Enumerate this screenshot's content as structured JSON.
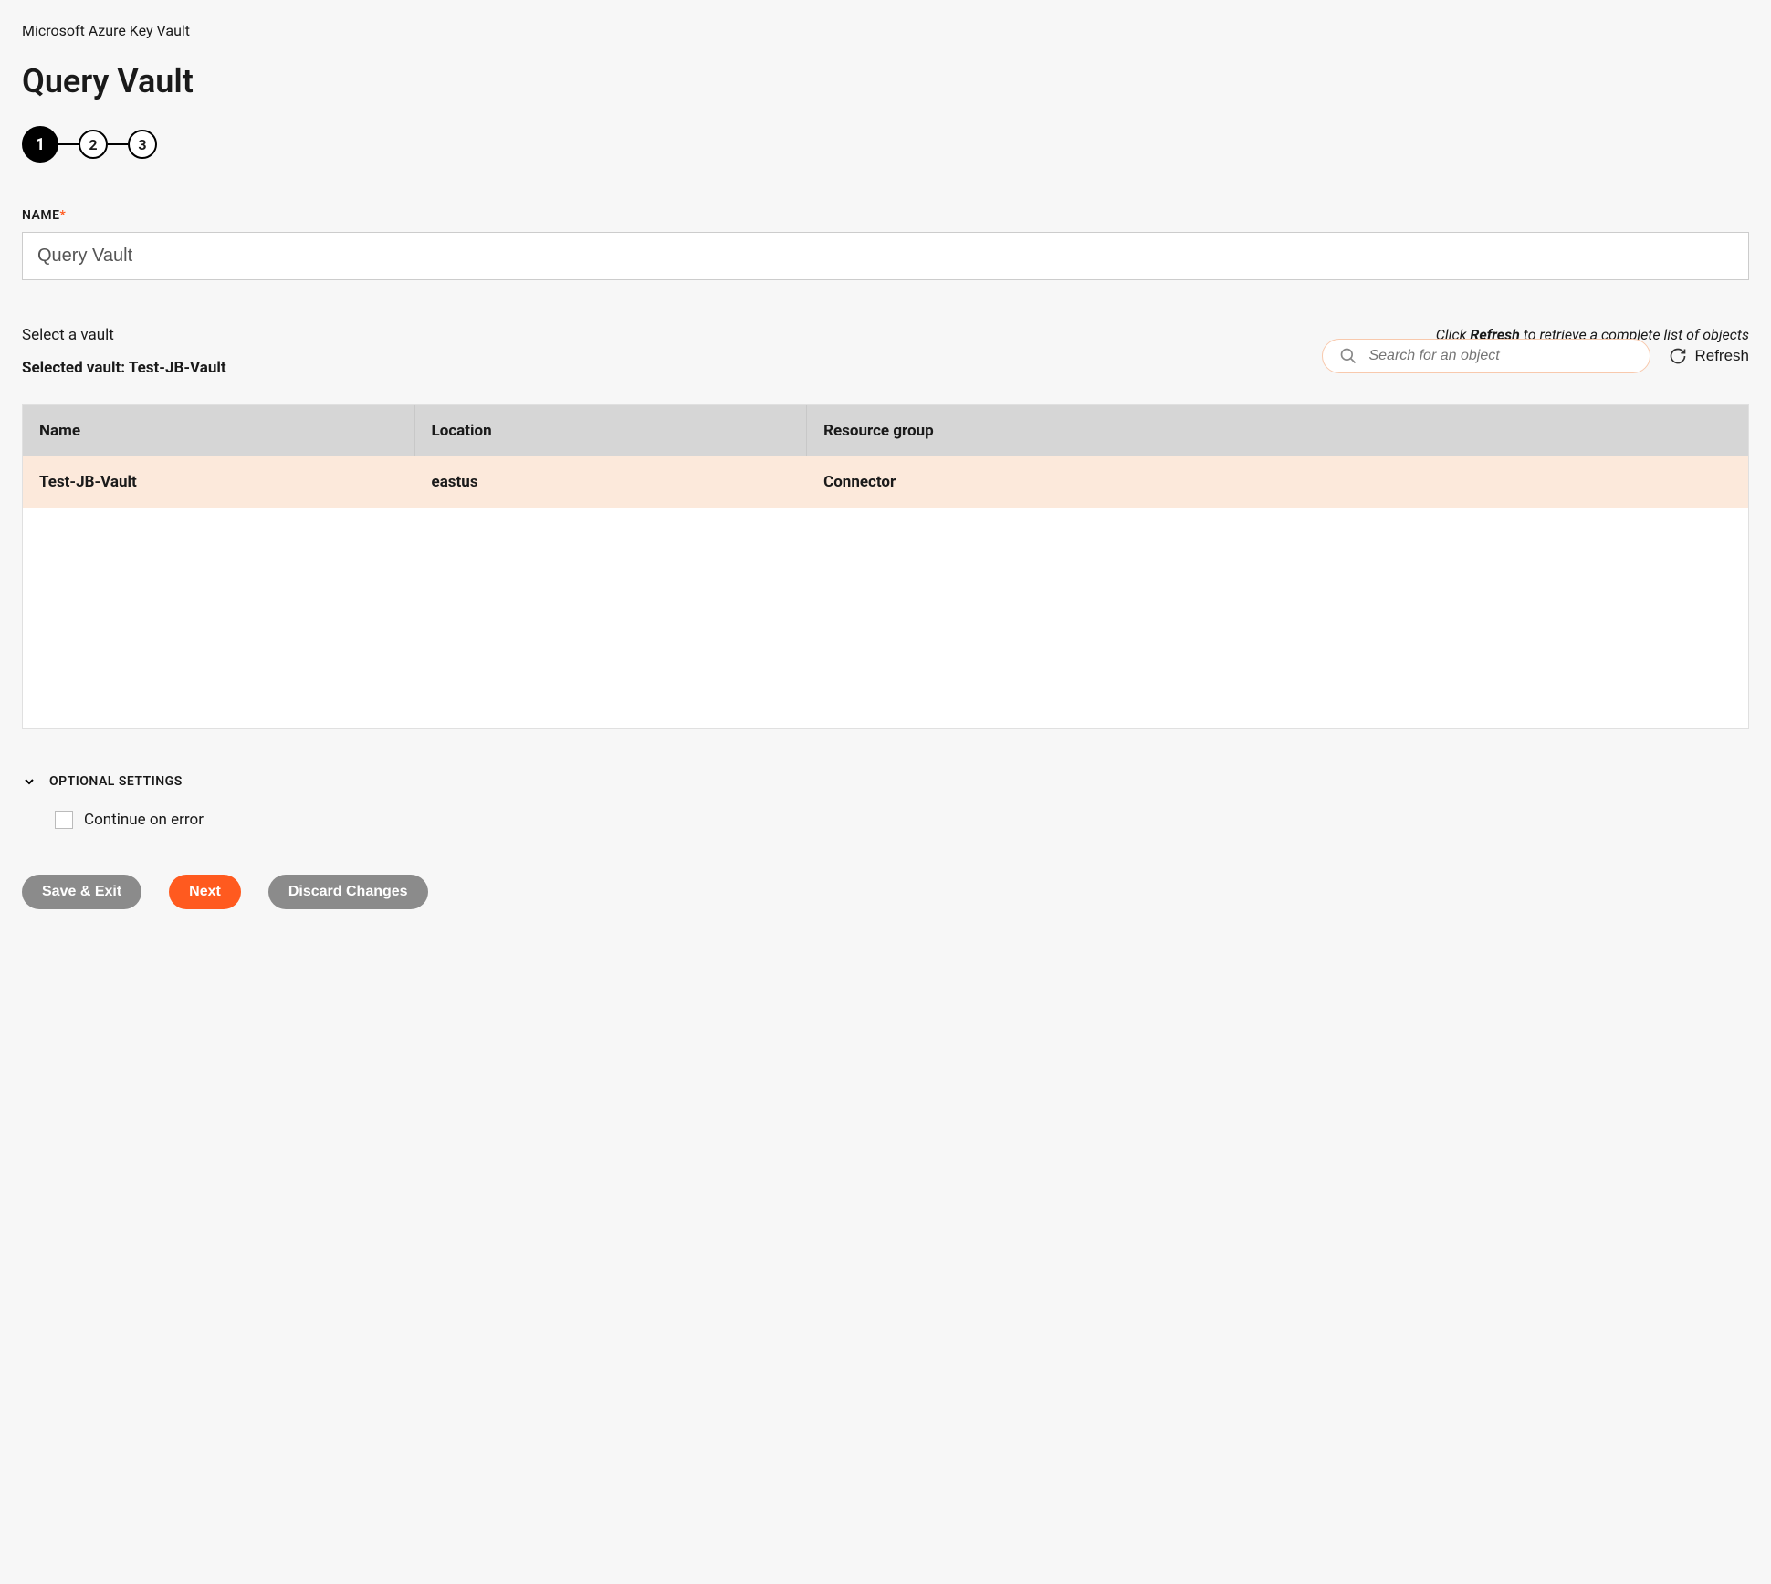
{
  "breadcrumb": "Microsoft Azure Key Vault",
  "title": "Query Vault",
  "steps": [
    "1",
    "2",
    "3"
  ],
  "nameField": {
    "label": "NAME",
    "value": "Query Vault"
  },
  "selectVaultLabel": "Select a vault",
  "hintPrefix": "Click ",
  "hintBold": "Refresh",
  "hintSuffix": " to retrieve a complete list of objects",
  "selectedVaultPrefix": "Selected vault: ",
  "selectedVaultName": "Test-JB-Vault",
  "searchPlaceholder": "Search for an object",
  "refreshLabel": "Refresh",
  "table": {
    "headers": {
      "name": "Name",
      "location": "Location",
      "resourceGroup": "Resource group"
    },
    "rows": [
      {
        "name": "Test-JB-Vault",
        "location": "eastus",
        "resourceGroup": "Connector"
      }
    ]
  },
  "optionalSettingsLabel": "OPTIONAL SETTINGS",
  "continueOnErrorLabel": "Continue on error",
  "continueOnErrorChecked": false,
  "buttons": {
    "saveExit": "Save & Exit",
    "next": "Next",
    "discard": "Discard Changes"
  }
}
